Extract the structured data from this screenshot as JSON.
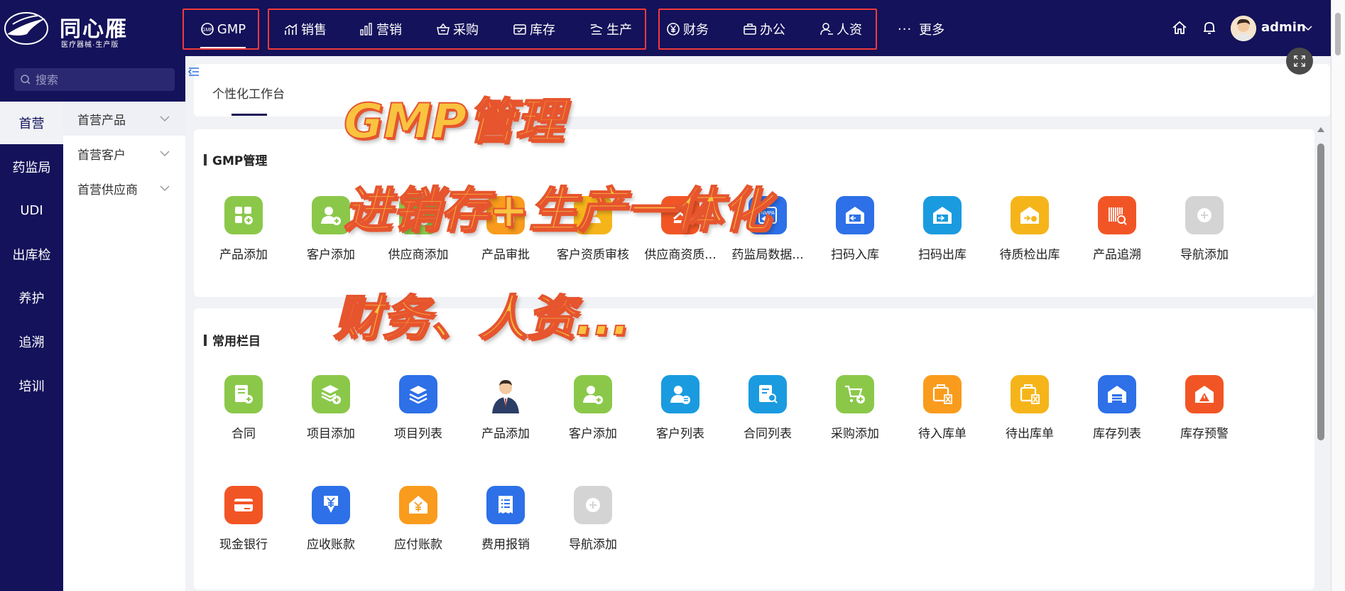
{
  "app": {
    "logo_title": "同心雁",
    "logo_subtitle": "医疗器械·生产版"
  },
  "topnav": {
    "items": [
      {
        "label": "GMP",
        "icon": "gmp-icon"
      },
      {
        "label": "销售",
        "icon": "chart-line-icon"
      },
      {
        "label": "营销",
        "icon": "bar-chart-icon"
      },
      {
        "label": "采购",
        "icon": "basket-icon"
      },
      {
        "label": "库存",
        "icon": "box-icon"
      },
      {
        "label": "生产",
        "icon": "factory-icon"
      },
      {
        "label": "财务",
        "icon": "yuan-circle-icon"
      },
      {
        "label": "办公",
        "icon": "briefcase-icon"
      },
      {
        "label": "人资",
        "icon": "user-icon"
      },
      {
        "label": "更多",
        "icon": "ellipsis-icon"
      }
    ],
    "user": "admin",
    "highlight_color": "#f13b3b"
  },
  "search": {
    "placeholder": "搜索"
  },
  "leftnav": {
    "items": [
      "首营",
      "药监局",
      "UDI",
      "出库检",
      "养护",
      "追溯",
      "培训"
    ],
    "active": "首营"
  },
  "subnav": {
    "items": [
      "首营产品",
      "首营客户",
      "首营供应商"
    ]
  },
  "tabs": {
    "active": "个性化工作台"
  },
  "sections": {
    "gmp": {
      "title": "GMP管理",
      "tiles": [
        "产品添加",
        "客户添加",
        "供应商添加",
        "产品审批",
        "客户资质审核",
        "供应商资质...",
        "药监局数据...",
        "扫码入库",
        "扫码出库",
        "待质检出库",
        "产品追溯",
        "导航添加"
      ]
    },
    "common": {
      "title": "常用栏目",
      "tiles_row1": [
        "合同",
        "项目添加",
        "项目列表",
        "产品添加",
        "客户添加",
        "客户列表",
        "合同列表",
        "采购添加",
        "待入库单",
        "待出库单",
        "库存列表",
        "库存预警"
      ],
      "tiles_row2": [
        "现金银行",
        "应收账款",
        "应付账款",
        "费用报销",
        "导航添加"
      ]
    }
  },
  "promo": {
    "line1": "GMP管理",
    "line2": "进销存+生产一体化",
    "line3": "财务、人资..."
  },
  "colors": {
    "nav_bg": "#14125a",
    "page_bg": "#f0f2f5",
    "promo_fill": "#f9c340",
    "promo_stroke": "#e6552e"
  }
}
